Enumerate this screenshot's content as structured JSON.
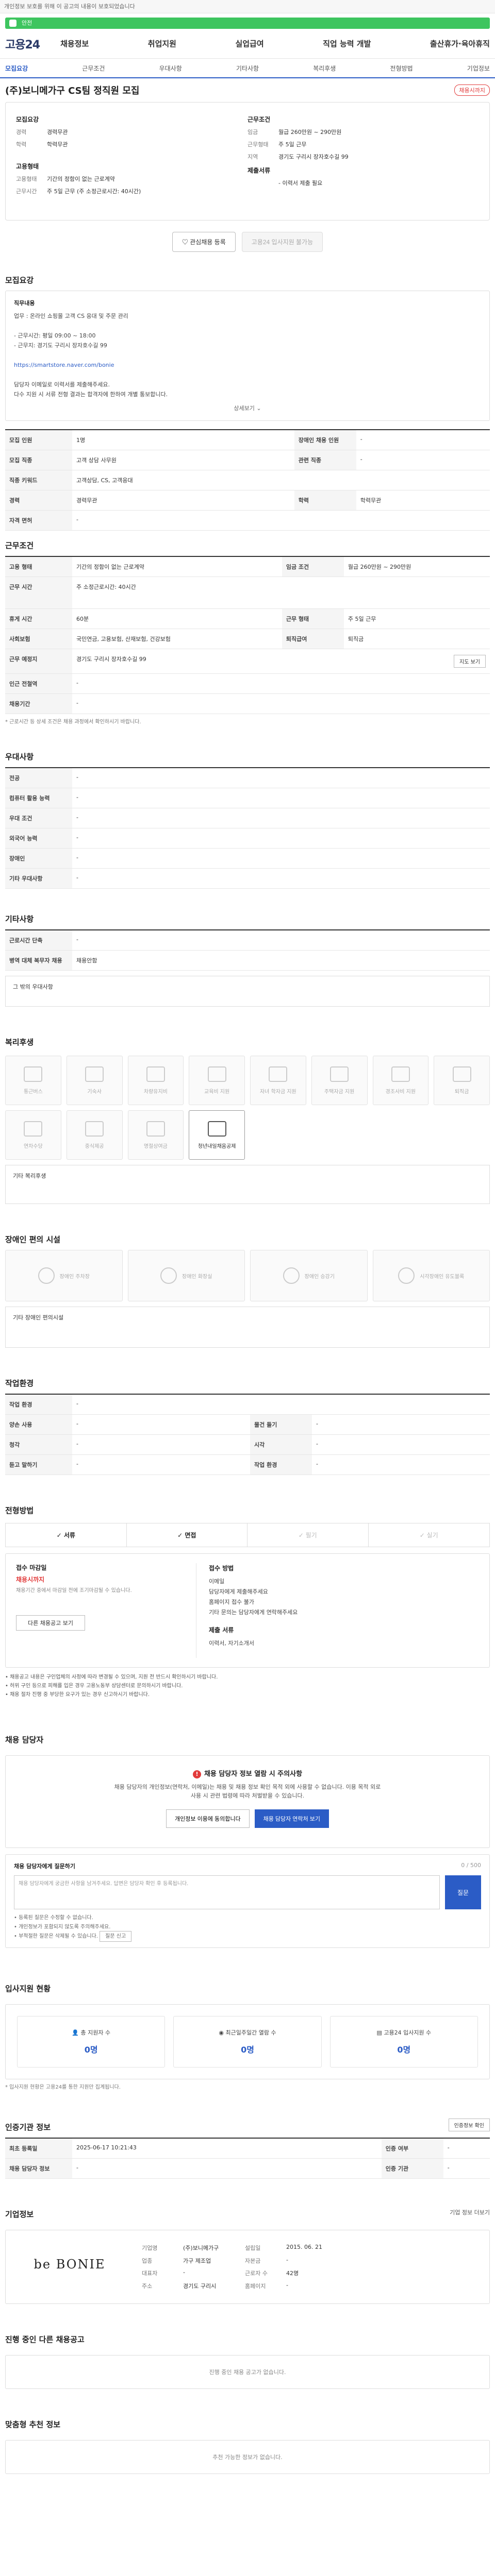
{
  "top_note": "개인정보 보호를 위해 이 공고의 내용이 보호되었습니다",
  "green_bar": "안전",
  "site": {
    "logo": "고용24",
    "nav": [
      "채용정보",
      "취업지원",
      "실업급여",
      "직업 능력 개발",
      "출산휴가·육아휴직"
    ]
  },
  "subnav": [
    "모집요강",
    "근무조건",
    "우대사항",
    "기타사항",
    "복리후생",
    "전형방법",
    "기업정보"
  ],
  "job": {
    "title": "(주)보니메가구 CS팀 정직원 모집",
    "badge": "채용시까지"
  },
  "summary": {
    "recruit_title": "모집요강",
    "recruit_rows": [
      {
        "k": "경력",
        "v": "경력무관"
      },
      {
        "k": "학력",
        "v": "학력무관"
      }
    ],
    "work_title": "근무조건",
    "work_rows": [
      {
        "k": "임금",
        "v": "월급 260만원 ~ 290만원"
      },
      {
        "k": "근무형태",
        "v": "주 5일 근무"
      },
      {
        "k": "지역",
        "v": "경기도 구리시 장자호수길 99"
      }
    ],
    "hire_title": "고용형태",
    "hire_rows": [
      {
        "k": "고용형태",
        "v": "기간의 정함이 없는 근로계약"
      },
      {
        "k": "근무시간",
        "v": "주 5일 근무 (주 소정근로시간: 40시간)"
      }
    ],
    "contact_title": "제출서류",
    "contact_rows": [
      {
        "k": "",
        "v": "- 이력서 제출 필요"
      }
    ]
  },
  "buttons": {
    "favorite": "관심채용 등록",
    "apply": "고용24 입사지원 불가능"
  },
  "recruit": {
    "section": "모집요강",
    "box_title": "직무내용",
    "box_lines": [
      "업무 : 온라인 쇼핑몰 고객 CS 응대 및 주문 관리",
      "",
      "- 근무시간: 평일 09:00 ~ 18:00",
      "- 근무지: 경기도 구리시 장자호수길 99",
      "",
      "https://smartstore.naver.com/bonie",
      "",
      "담당자 이메일로 이력서를 제출해주세요.",
      "다수 지원 시 서류 전형 결과는 합격자에 한하여 개별 통보합니다."
    ],
    "more": "상세보기",
    "rows": [
      [
        "모집 인원",
        "1명",
        "장애인 채용 인원",
        "-"
      ],
      [
        "모집 직종",
        "고객 상담 사무원",
        "관련 직종",
        "-"
      ],
      [
        "직종 키워드",
        "고객상담, CS, 고객응대",
        "",
        ""
      ],
      [
        "경력",
        "경력무관",
        "학력",
        "학력무관"
      ],
      [
        "자격 면허",
        "-",
        "",
        ""
      ]
    ]
  },
  "work": {
    "section": "근무조건",
    "rows": [
      [
        "고용 형태",
        "기간의 정함이 없는 근로계약",
        "임금 조건",
        "월급 260만원 ~ 290만원"
      ],
      [
        "근무 시간",
        "주 소정근로시간: 40시간",
        "",
        ""
      ],
      [
        "휴게 시간",
        "60분",
        "근무 형태",
        "주 5일 근무"
      ],
      [
        "사회보험",
        "국민연금, 고용보험, 산재보험, 건강보험",
        "퇴직급여",
        "퇴직금"
      ],
      [
        "근무 예정지",
        "경기도 구리시 장자호수길 99",
        "",
        ""
      ],
      [
        "인근 전철역",
        "-",
        "",
        ""
      ],
      [
        "채용기간",
        "-",
        "",
        ""
      ]
    ],
    "map_btn": "지도 보기",
    "note": "* 근로시간 등 상세 조건은 채용 과정에서 확인하시기 바랍니다."
  },
  "preferred": {
    "section": "우대사항",
    "rows": [
      [
        "전공",
        "-"
      ],
      [
        "컴퓨터 활용 능력",
        "-"
      ],
      [
        "우대 조건",
        "-"
      ],
      [
        "외국어 능력",
        "-"
      ],
      [
        "장애인",
        "-"
      ],
      [
        "기타 우대사항",
        "-"
      ]
    ]
  },
  "etc": {
    "section": "기타사항",
    "rows": [
      [
        "근로시간 단축",
        "-"
      ],
      [
        "병역 대체 복무자 채용",
        "채용안함"
      ]
    ],
    "extra": "그 밖의 우대사항"
  },
  "welfare": {
    "section": "복리후생",
    "cards": [
      "통근버스",
      "기숙사",
      "차량유지비",
      "교육비 지원",
      "자녀 학자금 지원",
      "주택자금 지원",
      "경조사비 지원",
      "퇴직금",
      "연차수당",
      "중식제공",
      "명절상여금",
      "청년내일채움공제"
    ],
    "on_index": 11,
    "extra_label": "기타 복리후생"
  },
  "disability": {
    "section": "장애인 편의 시설",
    "cards": [
      "장애인 주차장",
      "장애인 화장실",
      "장애인 승강기",
      "시각장애인 유도블록"
    ],
    "extra_label": "기타 장애인 편의시설"
  },
  "workenv": {
    "section": "작업환경",
    "rows": [
      [
        "작업 환경",
        "-",
        "",
        ""
      ],
      [
        "양손 사용",
        "-",
        "물건 들기",
        "-"
      ],
      [
        "청각",
        "-",
        "시각",
        "-"
      ],
      [
        "듣고 말하기",
        "-",
        "작업 환경",
        "-"
      ]
    ]
  },
  "process": {
    "section": "전형방법",
    "tabs": [
      "서류",
      "면접",
      "필기",
      "실기"
    ],
    "tab_on": [
      true,
      true,
      false,
      false
    ],
    "deadline_h": "접수 마감일",
    "deadline_v": "채용시까지",
    "deadline_sub": "채용기간 중에서 마감일 전에 조기마감될 수 있습니다.",
    "apply_btn": "다른 채용공고 보기",
    "method_h": "접수 방법",
    "method_lines": [
      "이메일",
      "담당자에게 제출해주세요",
      "홈페이지 접수 불가",
      "기타 문의는 담당자에게 연락해주세요"
    ],
    "doc_h": "제출 서류",
    "doc_lines": [
      "이력서, 자기소개서"
    ],
    "bullets": [
      "• 채용공고 내용은 구인업체의 사정에 따라 변경될 수 있으며, 지원 전 반드시 확인하시기 바랍니다.",
      "• 허위 구인 등으로 피해를 입은 경우 고용노동부 상담센터로 문의하시기 바랍니다.",
      "• 채용 절차 진행 중 부당한 요구가 있는 경우 신고하시기 바랍니다."
    ]
  },
  "manager": {
    "section": "채용 담당자",
    "alert_title": "채용 담당자 정보 열람 시 주의사항",
    "alert_text": "채용 담당자의 개인정보(연락처, 이메일)는 채용 및 채용 정보 확인 목적 외에 사용할 수 없습니다. 이용 목적 외로 사용 시 관련 법령에 따라 처벌받을 수 있습니다.",
    "btn1": "개인정보 이용에 동의합니다",
    "btn2": "채용 담당자 연락처 보기"
  },
  "inquiry": {
    "title": "채용 담당자에게 질문하기",
    "count": "0 / 500",
    "placeholder": "채용 담당자에게 궁금한 사항을 남겨주세요. 답변은 담당자 확인 후 등록됩니다.",
    "submit": "질문",
    "notes": [
      "• 등록된 질문은 수정할 수 없습니다.",
      "• 개인정보가 포함되지 않도록 주의해주세요.",
      "• 부적절한 질문은 삭제될 수 있습니다."
    ],
    "report_btn": "질문 신고"
  },
  "status": {
    "section": "입사지원 현황",
    "items": [
      {
        "label": "총 지원자 수",
        "value": "0명"
      },
      {
        "label": "최근일주일간 열람 수",
        "value": "0명"
      },
      {
        "label": "고용24 입사지원 수",
        "value": "0명"
      }
    ],
    "note": "* 입사지원 현황은 고용24를 통한 지원만 집계됩니다."
  },
  "cert": {
    "section": "인증기관 정보",
    "btn": "인증정보 확인",
    "rows": [
      [
        "최초 등록일",
        "2025-06-17 10:21:43",
        "인증 여부",
        "-"
      ],
      [
        "채용 담당자 정보",
        "-",
        "인증 기관",
        "-"
      ]
    ]
  },
  "company": {
    "section": "기업정보",
    "btn": "기업 정보 더보기",
    "logo_text": "be BONIE",
    "rows": [
      [
        "기업명",
        "(주)보니메가구",
        "설립일",
        "2015. 06. 21"
      ],
      [
        "업종",
        "가구 제조업",
        "자본금",
        "-"
      ],
      [
        "대표자",
        "-",
        "근로자 수",
        "42명"
      ],
      [
        "주소",
        "경기도 구리시",
        "홈페이지",
        "-"
      ]
    ]
  },
  "other_posts": {
    "section": "진행 중인 다른 채용공고",
    "text": "진행 중인 채용 공고가 없습니다."
  },
  "recommend": {
    "section": "맞춤형 추천 정보",
    "text": "추천 가능한 정보가 없습니다."
  }
}
